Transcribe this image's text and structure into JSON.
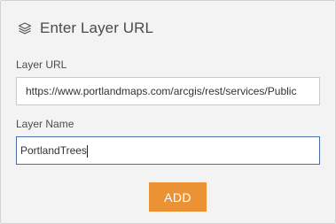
{
  "header": {
    "icon": "layers-icon",
    "title": "Enter Layer URL"
  },
  "url_field": {
    "label": "Layer URL",
    "value": "https://www.portlandmaps.com/arcgis/rest/services/Public"
  },
  "name_field": {
    "label": "Layer Name",
    "value": "PortlandTrees"
  },
  "add_button": {
    "label": "ADD",
    "color": "#eb9334"
  },
  "colors": {
    "panel_bg": "#f3f3f3",
    "focus_border": "#4a6ea8"
  }
}
